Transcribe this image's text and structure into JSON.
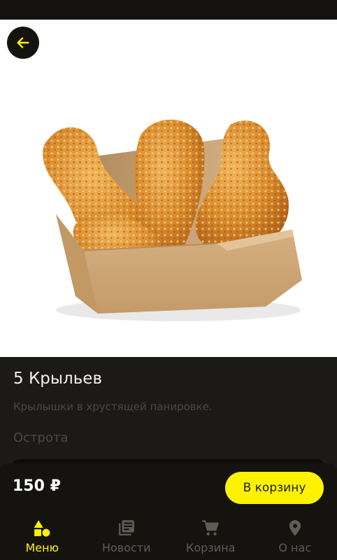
{
  "product": {
    "title": "5 Крыльев",
    "description": "Крылышки в хрустящей панировке.",
    "spice_label": "Острота",
    "image_name": "fried-chicken-wings-in-box"
  },
  "cart_bar": {
    "price": "150 ₽",
    "add_button_label": "В корзину"
  },
  "nav": {
    "items": [
      {
        "label": "Меню",
        "icon": "menu-shapes-icon",
        "active": true
      },
      {
        "label": "Новости",
        "icon": "news-icon",
        "active": false
      },
      {
        "label": "Корзина",
        "icon": "cart-icon",
        "active": false
      },
      {
        "label": "О нас",
        "icon": "location-pin-icon",
        "active": false
      }
    ]
  },
  "colors": {
    "accent": "#fff200",
    "background": "#1b1a17",
    "nav_background": "#141310",
    "muted_text": "#4a4843"
  }
}
